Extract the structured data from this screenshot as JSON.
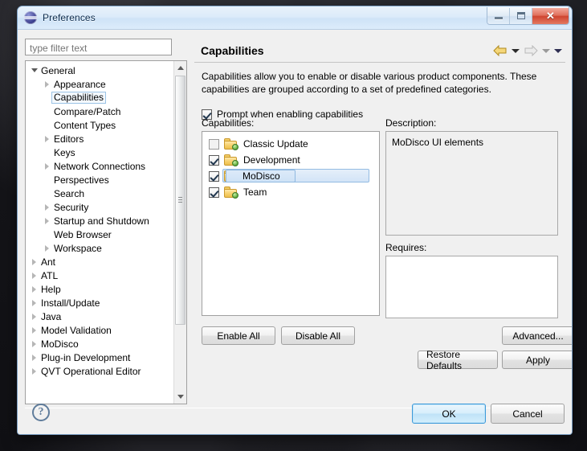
{
  "window": {
    "title": "Preferences",
    "app_icon": "eclipse-icon",
    "buttons": {
      "minimize": "minimize-icon",
      "maximize": "restore-icon",
      "close": "✕"
    }
  },
  "filter": {
    "placeholder": "type filter text",
    "value": ""
  },
  "tree": {
    "items": [
      {
        "label": "General",
        "level": 0,
        "expandable": true,
        "expanded": true,
        "selected": false
      },
      {
        "label": "Appearance",
        "level": 1,
        "expandable": true,
        "expanded": false,
        "selected": false
      },
      {
        "label": "Capabilities",
        "level": 1,
        "expandable": false,
        "expanded": false,
        "selected": true
      },
      {
        "label": "Compare/Patch",
        "level": 1,
        "expandable": false,
        "expanded": false,
        "selected": false
      },
      {
        "label": "Content Types",
        "level": 1,
        "expandable": false,
        "expanded": false,
        "selected": false
      },
      {
        "label": "Editors",
        "level": 1,
        "expandable": true,
        "expanded": false,
        "selected": false
      },
      {
        "label": "Keys",
        "level": 1,
        "expandable": false,
        "expanded": false,
        "selected": false
      },
      {
        "label": "Network Connections",
        "level": 1,
        "expandable": true,
        "expanded": false,
        "selected": false
      },
      {
        "label": "Perspectives",
        "level": 1,
        "expandable": false,
        "expanded": false,
        "selected": false
      },
      {
        "label": "Search",
        "level": 1,
        "expandable": false,
        "expanded": false,
        "selected": false
      },
      {
        "label": "Security",
        "level": 1,
        "expandable": true,
        "expanded": false,
        "selected": false
      },
      {
        "label": "Startup and Shutdown",
        "level": 1,
        "expandable": true,
        "expanded": false,
        "selected": false
      },
      {
        "label": "Web Browser",
        "level": 1,
        "expandable": false,
        "expanded": false,
        "selected": false
      },
      {
        "label": "Workspace",
        "level": 1,
        "expandable": true,
        "expanded": false,
        "selected": false
      },
      {
        "label": "Ant",
        "level": 0,
        "expandable": true,
        "expanded": false,
        "selected": false
      },
      {
        "label": "ATL",
        "level": 0,
        "expandable": true,
        "expanded": false,
        "selected": false
      },
      {
        "label": "Help",
        "level": 0,
        "expandable": true,
        "expanded": false,
        "selected": false
      },
      {
        "label": "Install/Update",
        "level": 0,
        "expandable": true,
        "expanded": false,
        "selected": false
      },
      {
        "label": "Java",
        "level": 0,
        "expandable": true,
        "expanded": false,
        "selected": false
      },
      {
        "label": "Model Validation",
        "level": 0,
        "expandable": true,
        "expanded": false,
        "selected": false
      },
      {
        "label": "MoDisco",
        "level": 0,
        "expandable": true,
        "expanded": false,
        "selected": false
      },
      {
        "label": "Plug-in Development",
        "level": 0,
        "expandable": true,
        "expanded": false,
        "selected": false
      },
      {
        "label": "QVT Operational Editor",
        "level": 0,
        "expandable": true,
        "expanded": false,
        "selected": false
      }
    ]
  },
  "page": {
    "title": "Capabilities",
    "description": "Capabilities allow you to enable or disable various product components.  These capabilities are grouped according to a set of predefined categories.",
    "nav": {
      "back_icon": "back-arrow-icon",
      "back_menu_icon": "chevron-down-icon",
      "forward_icon": "forward-arrow-icon",
      "forward_menu_icon": "chevron-down-icon",
      "more_menu_icon": "chevron-down-icon"
    },
    "prompt_checkbox": {
      "label": "Prompt when enabling capabilities",
      "checked": true
    },
    "capabilities_label": "Capabilities:",
    "capabilities": [
      {
        "label": "Classic Update",
        "checked": false,
        "selected": false,
        "icon": "folder-icon"
      },
      {
        "label": "Development",
        "checked": true,
        "selected": false,
        "icon": "folder-icon"
      },
      {
        "label": "MoDisco",
        "checked": true,
        "selected": true,
        "icon": "folder-icon"
      },
      {
        "label": "Team",
        "checked": true,
        "selected": false,
        "icon": "folder-icon"
      }
    ],
    "description_label": "Description:",
    "description_value": "MoDisco UI elements",
    "requires_label": "Requires:",
    "requires_value": "",
    "buttons": {
      "enable_all": "Enable All",
      "disable_all": "Disable All",
      "advanced": "Advanced...",
      "restore_defaults": "Restore Defaults",
      "apply": "Apply"
    }
  },
  "footer": {
    "help_icon": "help-icon",
    "help_glyph": "?",
    "ok": "OK",
    "cancel": "Cancel"
  },
  "colors": {
    "titlebar": "#dcebfa",
    "dialog_bg": "#f0f0f0",
    "close_button": "#cf4530",
    "accent_selection": "#cfe2f6",
    "ok_border": "#3c9ad9",
    "folder_yellow": "#f3cd66",
    "folder_badge_green": "#5aa83a"
  }
}
